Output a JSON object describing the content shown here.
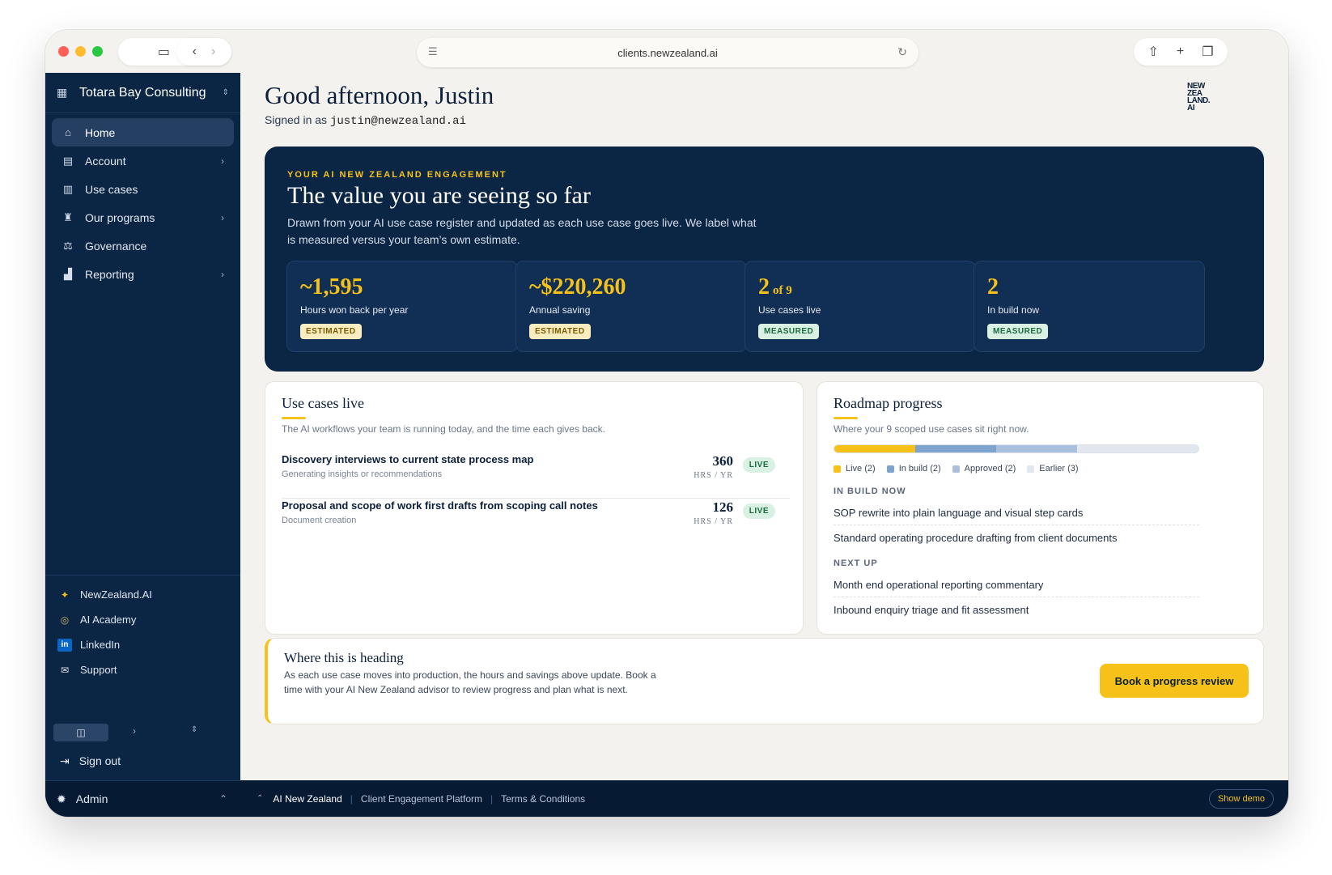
{
  "browser": {
    "url": "clients.newzealand.ai"
  },
  "sidebar": {
    "org_name": "Totara Bay Consulting",
    "nav": [
      {
        "label": "Home"
      },
      {
        "label": "Account"
      },
      {
        "label": "Use cases"
      },
      {
        "label": "Our programs"
      },
      {
        "label": "Governance"
      },
      {
        "label": "Reporting"
      }
    ],
    "links": [
      {
        "label": "NewZealand.AI"
      },
      {
        "label": "AI Academy"
      },
      {
        "label": "LinkedIn"
      },
      {
        "label": "Support"
      }
    ],
    "sign_out": "Sign out",
    "admin": "Admin"
  },
  "header": {
    "greeting": "Good afternoon, Justin",
    "signed_in_prefix": "Signed in as",
    "email": "justin@newzealand.ai",
    "logo_lines": [
      "NEW",
      "ZEA",
      "LAND.",
      "AI"
    ]
  },
  "hero": {
    "kicker": "YOUR AI NEW ZEALAND ENGAGEMENT",
    "title": "The value you are seeing so far",
    "description": "Drawn from your AI use case register and updated as each use case goes live. We label what is measured versus your team’s own estimate.",
    "stats": [
      {
        "value": "~1,595",
        "suffix": "",
        "label": "Hours won back per year",
        "badge": "ESTIMATED"
      },
      {
        "value": "~$220,260",
        "suffix": "",
        "label": "Annual saving",
        "badge": "ESTIMATED"
      },
      {
        "value": "2",
        "suffix": "of 9",
        "label": "Use cases live",
        "badge": "MEASURED"
      },
      {
        "value": "2",
        "suffix": "",
        "label": "In build now",
        "badge": "MEASURED"
      }
    ]
  },
  "use_cases": {
    "title": "Use cases live",
    "subtitle": "The AI workflows your team is running today, and the time each gives back.",
    "items": [
      {
        "name": "Discovery interviews to current state process map",
        "category": "Generating insights or recommendations",
        "hours": "360",
        "unit": "HRS / YR",
        "status": "LIVE"
      },
      {
        "name": "Proposal and scope of work first drafts from scoping call notes",
        "category": "Document creation",
        "hours": "126",
        "unit": "HRS / YR",
        "status": "LIVE"
      }
    ]
  },
  "roadmap": {
    "title": "Roadmap progress",
    "subtitle": "Where your 9 scoped use cases sit right now.",
    "segments": [
      {
        "label": "Live (2)",
        "count": 2,
        "color": "#f6c21a"
      },
      {
        "label": "In build (2)",
        "count": 2,
        "color": "#7fa3cf"
      },
      {
        "label": "Approved (2)",
        "count": 2,
        "color": "#a9c0dd"
      },
      {
        "label": "Earlier (3)",
        "count": 3,
        "color": "#e2e7ee"
      }
    ],
    "in_build_label": "IN BUILD NOW",
    "in_build": [
      "SOP rewrite into plain language and visual step cards",
      "Standard operating procedure drafting from client documents"
    ],
    "next_up_label": "NEXT UP",
    "next_up": [
      "Month end operational reporting commentary",
      "Inbound enquiry triage and fit assessment"
    ]
  },
  "heading": {
    "title": "Where this is heading",
    "body": "As each use case moves into production, the hours and savings above update. Book a time with your AI New Zealand advisor to review progress and plan what is next.",
    "cta": "Book a progress review"
  },
  "footer": {
    "brand": "AI New Zealand",
    "platform": "Client Engagement Platform",
    "terms": "Terms & Conditions",
    "demo": "Show demo"
  },
  "colors": {
    "navy": "#0b2545",
    "accent": "#f6c21a",
    "measured_green": "#1c6b3f"
  }
}
